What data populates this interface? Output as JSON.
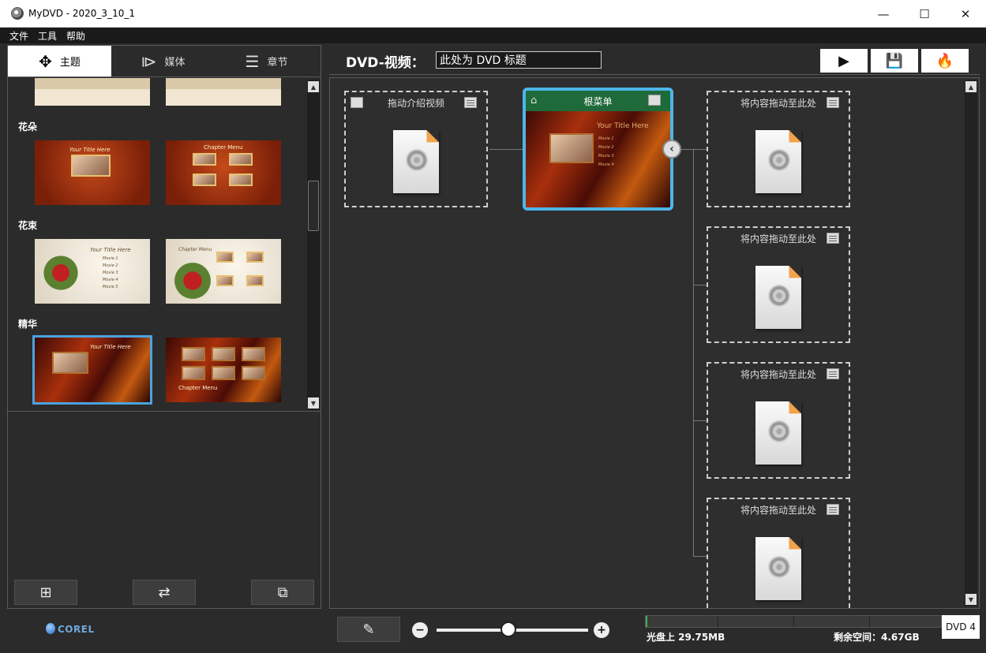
{
  "window": {
    "title": "MyDVD - 2020_3_10_1",
    "minimize": "—",
    "maximize": "☐",
    "close": "✕"
  },
  "menu": [
    "文件",
    "工具",
    "帮助"
  ],
  "tabs": [
    {
      "label": "主题",
      "icon": "theme-icon"
    },
    {
      "label": "媒体",
      "icon": "media-icon"
    },
    {
      "label": "章节",
      "icon": "chapter-icon"
    }
  ],
  "theme_groups": [
    {
      "label": "花朵"
    },
    {
      "label": "花束"
    },
    {
      "label": "精华"
    }
  ],
  "thumb_text": {
    "your_title_here": "Your Title Here",
    "chapter_menu": "Chapter Menu",
    "movie1": "Movie 1",
    "movie2": "Movie 2",
    "movie3": "Movie 3",
    "movie4": "Movie 4",
    "movie5": "Movie 5"
  },
  "header": {
    "label": "DVD-视频：",
    "title_value": "此处为 DVD 标题"
  },
  "nodes": {
    "intro": "拖动介绍视频",
    "root": "根菜单",
    "drop": "将内容拖动至此处"
  },
  "status": {
    "used": "光盘上 29.75MB",
    "free": "剩余空间：4.67GB",
    "disc_type": "DVD 4",
    "used_fraction": 0.006
  },
  "brand": "COREL",
  "colors": {
    "accent": "#4db6e8",
    "root_header": "#1f6a3a",
    "disc_fill": "#3bb35a"
  }
}
